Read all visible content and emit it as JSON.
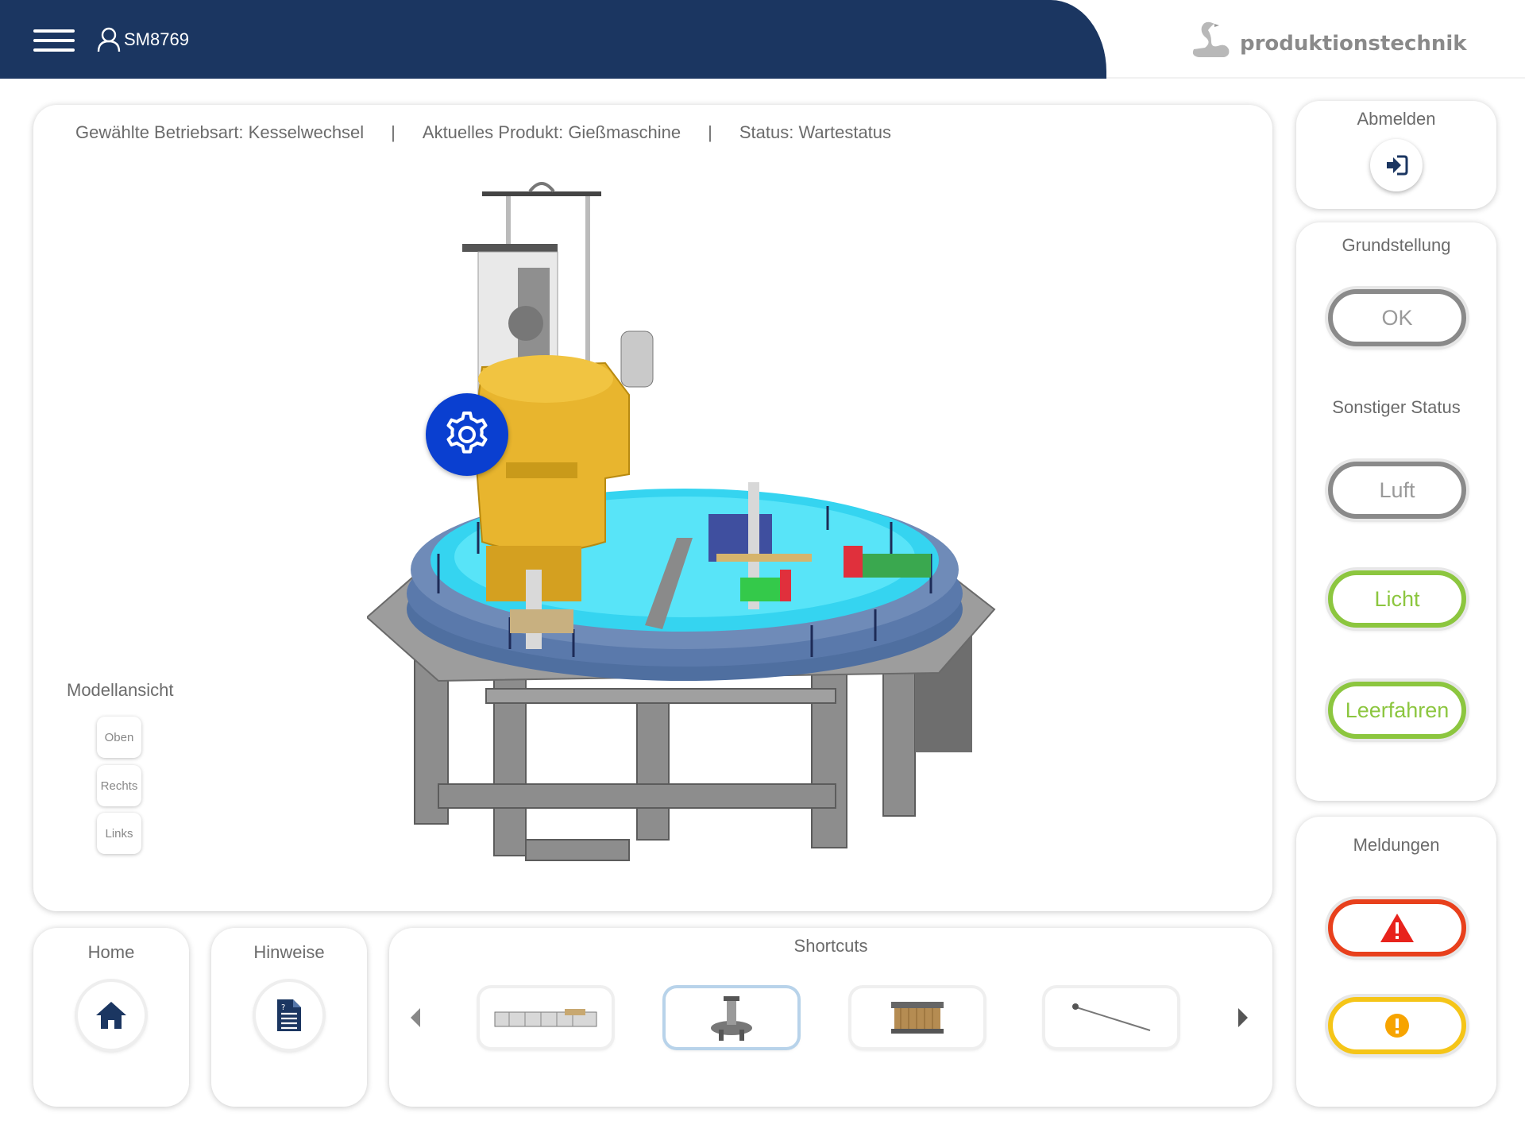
{
  "header": {
    "user": "SM8769",
    "brand": "produktionstechnik"
  },
  "status_bar": {
    "mode": "Gewählte Betriebsart: Kesselwechsel",
    "product": "Aktuelles Produkt: Gießmaschine",
    "status": "Status: Wartestatus",
    "separator": "|"
  },
  "model_view": {
    "label": "Modellansicht",
    "buttons": [
      "Oben",
      "Rechts",
      "Links"
    ]
  },
  "logout": {
    "label": "Abmelden"
  },
  "status_panel": {
    "grundstellung_label": "Grundstellung",
    "ok_label": "OK",
    "sonstiger_label": "Sonstiger Status",
    "luft_label": "Luft",
    "licht_label": "Licht",
    "leerfahren_label": "Leerfahren"
  },
  "messages": {
    "label": "Meldungen"
  },
  "home": {
    "label": "Home"
  },
  "hints": {
    "label": "Hinweise"
  },
  "shortcuts": {
    "label": "Shortcuts",
    "active_index": 1
  },
  "colors": {
    "header": "#1b3661",
    "accent_blue": "#0a3fd0",
    "ok_green": "#8cc63f",
    "error_red": "#e8401c",
    "warning_yellow": "#f5c518",
    "neutral_grey": "#8a8a8a"
  },
  "icons": [
    "menu-icon",
    "user-icon",
    "swan-logo",
    "gear-icon",
    "logout-icon",
    "home-icon",
    "document-icon",
    "warning-triangle-icon",
    "info-circle-icon",
    "arrow-left-icon",
    "arrow-right-icon"
  ]
}
